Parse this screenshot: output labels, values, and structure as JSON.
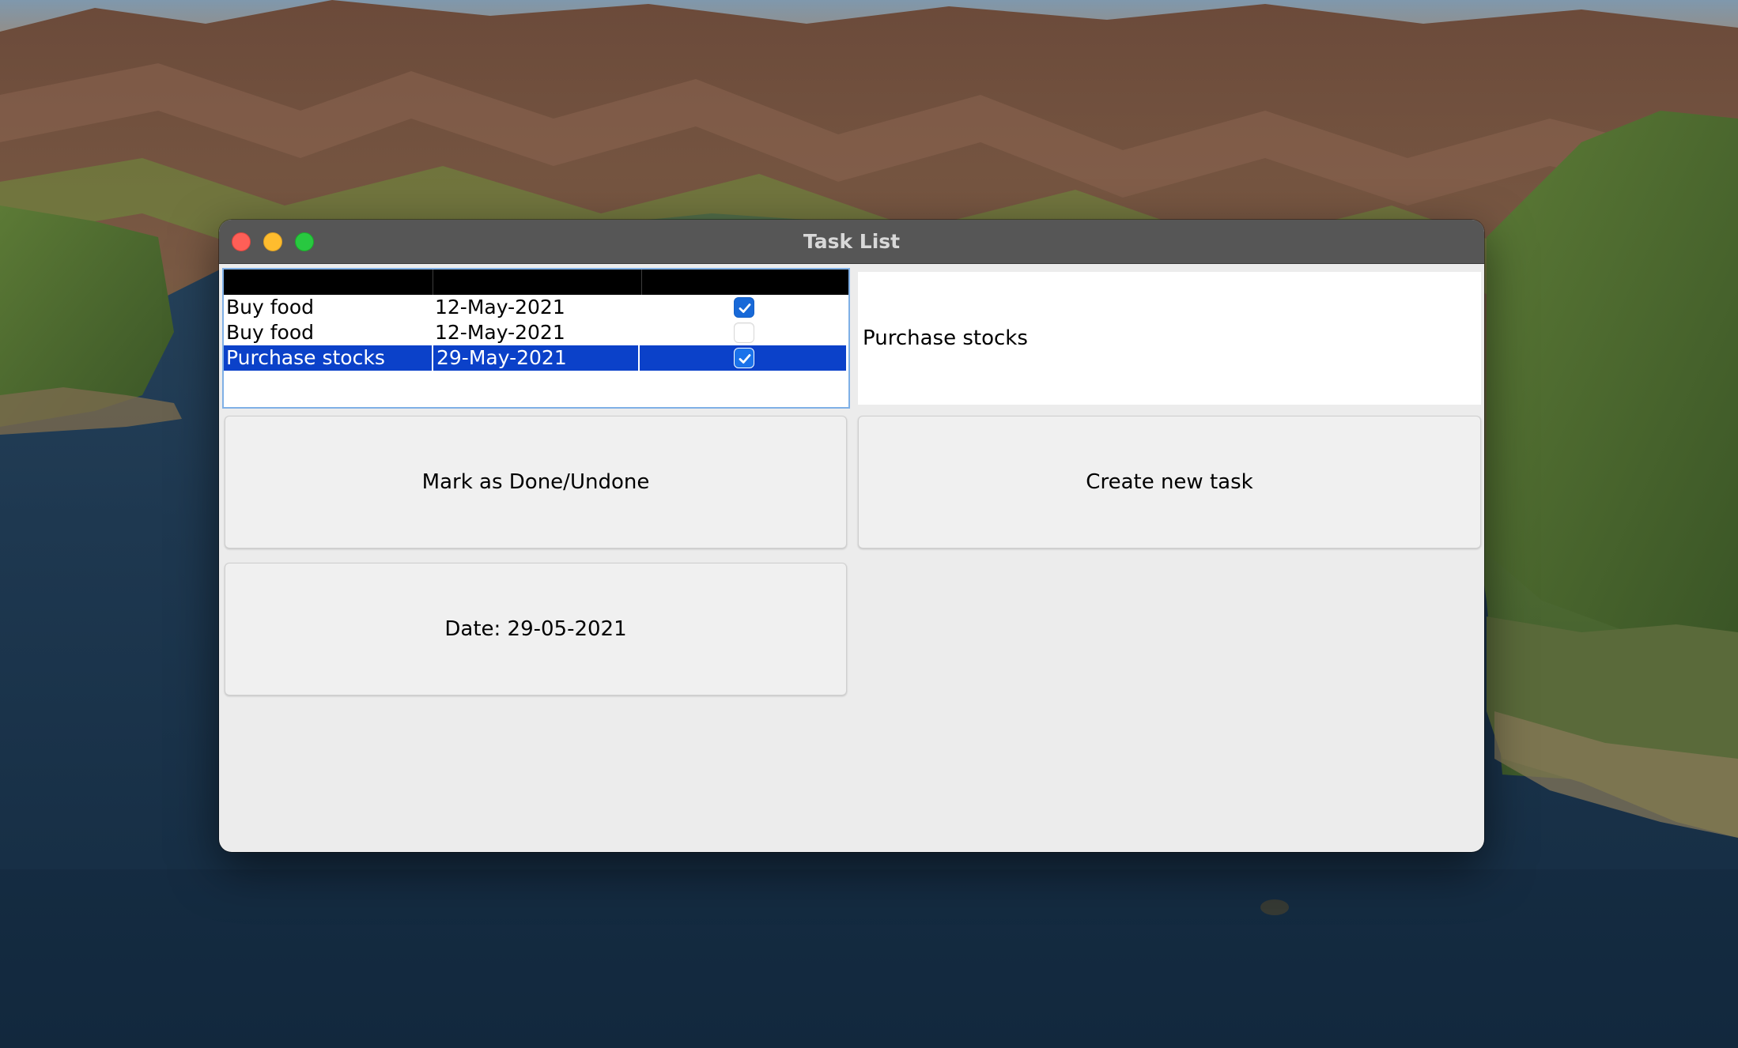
{
  "window": {
    "title": "Task List"
  },
  "task_table": {
    "columns": [
      "",
      "",
      ""
    ],
    "rows": [
      {
        "name": "Buy food",
        "date": "12-May-2021",
        "done": true,
        "selected": false
      },
      {
        "name": "Buy food",
        "date": "12-May-2021",
        "done": false,
        "selected": false
      },
      {
        "name": "Purchase stocks",
        "date": "29-May-2021",
        "done": true,
        "selected": true
      }
    ]
  },
  "detail": {
    "task_name": "Purchase stocks"
  },
  "buttons": {
    "mark_label": "Mark as Done/Undone",
    "create_label": "Create new task",
    "date_label": "Date: 29-05-2021"
  },
  "colors": {
    "selection": "#0b41c9",
    "checkbox": "#1869d8",
    "titlebar": "#565656",
    "window_bg": "#ececec",
    "focus_ring": "#7fb0e6"
  },
  "icons": {
    "close": "close-icon",
    "minimize": "minimize-icon",
    "zoom": "zoom-icon",
    "checkmark": "checkmark-icon"
  }
}
